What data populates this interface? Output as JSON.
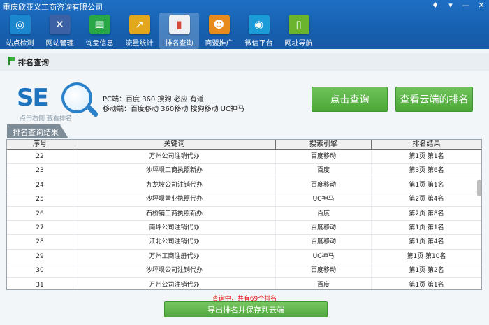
{
  "window": {
    "title": "重庆欣亚义工商咨询有限公司",
    "controls": [
      "♦",
      "▾",
      "—",
      "✕"
    ]
  },
  "toolbar": {
    "items": [
      {
        "label": "站点检测",
        "icon": "site-check-icon",
        "color": "#1a87cf",
        "glyph": "◎"
      },
      {
        "label": "网站管理",
        "icon": "tools-icon",
        "color": "#3c62a5",
        "glyph": "✕"
      },
      {
        "label": "询盘信息",
        "icon": "message-icon",
        "color": "#29a746",
        "glyph": "▤"
      },
      {
        "label": "流量统计",
        "icon": "trend-icon",
        "color": "#e3a71b",
        "glyph": "↗"
      },
      {
        "label": "排名查询",
        "icon": "bar-chart-icon",
        "color": "#eef1f4",
        "glyph": "▮"
      },
      {
        "label": "商盟推广",
        "icon": "users-icon",
        "color": "#e68b1c",
        "glyph": "☻"
      },
      {
        "label": "微信平台",
        "icon": "wechat-icon",
        "color": "#1b9cd8",
        "glyph": "◉"
      },
      {
        "label": "网址导航",
        "icon": "mouse-icon",
        "color": "#6ab52d",
        "glyph": "▯"
      }
    ],
    "active_index": 4
  },
  "section": {
    "title": "排名查询"
  },
  "logo": {
    "text": "SE",
    "tagline": "点击右侧 查看排名"
  },
  "desc": {
    "pc": "PC端：百度 360 搜狗 必应 有道",
    "mobile": "移动端：百度移动 360移动 搜狗移动 UC神马"
  },
  "buttons": {
    "query": "点击查询",
    "cloud": "查看云端的排名",
    "export": "导出排名并保存到云端"
  },
  "results_tab": "排名查询结果",
  "table": {
    "columns": [
      "序号",
      "关键词",
      "搜索引擎",
      "排名结果"
    ],
    "rows": [
      [
        "22",
        "万州公司注销代办",
        "百度移动",
        "第1页 第1名"
      ],
      [
        "23",
        "沙坪坝工商执照新办",
        "百度",
        "第3页 第6名"
      ],
      [
        "24",
        "九龙坡公司注销代办",
        "百度移动",
        "第1页 第1名"
      ],
      [
        "25",
        "沙坪坝营业执照代办",
        "UC神马",
        "第2页 第4名"
      ],
      [
        "26",
        "石桥铺工商执照新办",
        "百度",
        "第2页 第8名"
      ],
      [
        "27",
        "南坪公司注销代办",
        "百度移动",
        "第1页 第1名"
      ],
      [
        "28",
        "江北公司注销代办",
        "百度移动",
        "第1页 第4名"
      ],
      [
        "29",
        "万州工商注册代办",
        "UC神马",
        "第1页 第10名"
      ],
      [
        "30",
        "沙坪坝公司注销代办",
        "百度移动",
        "第1页 第2名"
      ],
      [
        "31",
        "万州公司注销代办",
        "百度",
        "第1页 第1名"
      ]
    ]
  },
  "status": "查询中，共有69个排名"
}
